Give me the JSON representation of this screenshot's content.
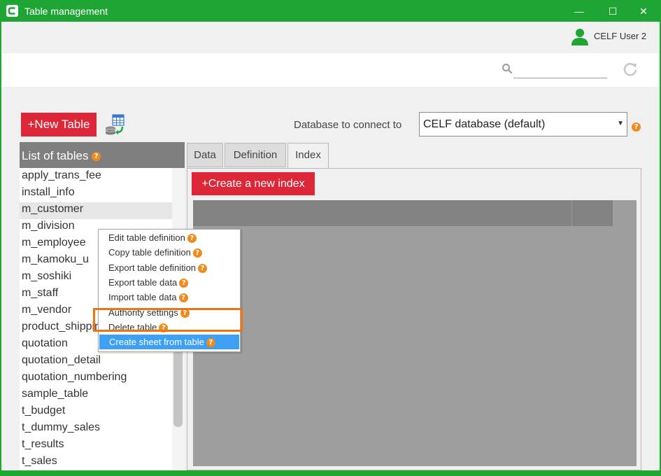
{
  "window": {
    "title": "Table management",
    "controls": {
      "minimize": "—",
      "maximize": "☐",
      "close": "✕"
    },
    "accent_color": "#1fa533"
  },
  "user": {
    "name": "CELF User 2",
    "icon": "user-icon"
  },
  "search": {
    "value": "",
    "placeholder": ""
  },
  "toolbar": {
    "new_table_label": "+New Table",
    "db_label": "Database to connect to",
    "db_selected": "CELF database (default)"
  },
  "table_list": {
    "header": "List of tables",
    "items": [
      "apply_trans_fee",
      "install_info",
      "m_customer",
      "m_division",
      "m_employee",
      "m_kamoku_u",
      "m_soshiki",
      "m_staff",
      "m_vendor",
      "product_shipping",
      "quotation",
      "quotation_detail",
      "quotation_numbering",
      "sample_table",
      "t_budget",
      "t_dummy_sales",
      "t_results",
      "t_sales"
    ],
    "selected_index": 2
  },
  "tabs": [
    "Data",
    "Definition",
    "Index"
  ],
  "active_tab": "Index",
  "index_panel": {
    "create_button": "+Create a new index"
  },
  "context_menu": {
    "items": [
      "Edit table definition",
      "Copy table definition",
      "Export table definition",
      "Export table data",
      "Import table data",
      "Authority settings",
      "Delete table",
      "Create sheet from table"
    ],
    "highlighted": "Create sheet from table",
    "highlight_color": "#3ca0f4",
    "frame_color": "#e8751a"
  },
  "help_glyph": "?",
  "colors": {
    "primary_button": "#dd2638",
    "help_badge": "#f08a1d"
  }
}
